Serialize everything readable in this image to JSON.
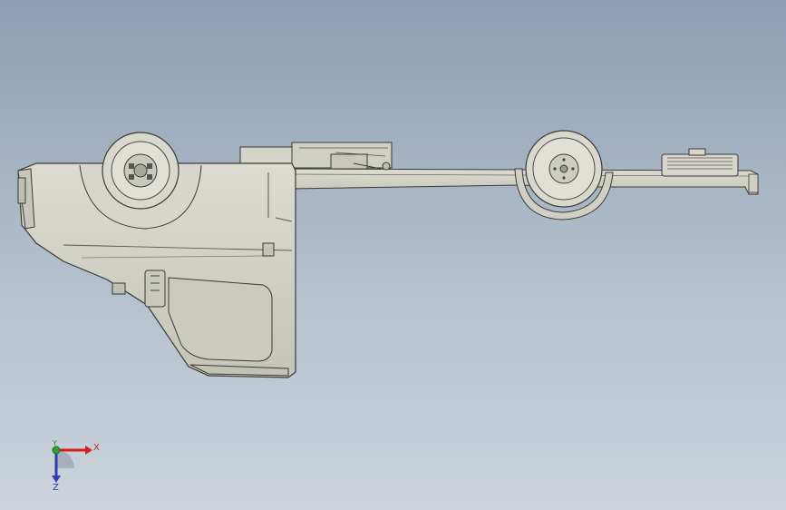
{
  "viewport": {
    "background_top": "#8e9fb3",
    "background_bottom": "#ccd3dc",
    "model_fill": "#d2d2c6",
    "model_edge": "#3a3a34"
  },
  "triad": {
    "x_label": "X",
    "y_label": "Y",
    "z_label": "Z",
    "x_color": "#d0202a",
    "y_color": "#2fa02f",
    "z_color": "#2a3fb0"
  }
}
